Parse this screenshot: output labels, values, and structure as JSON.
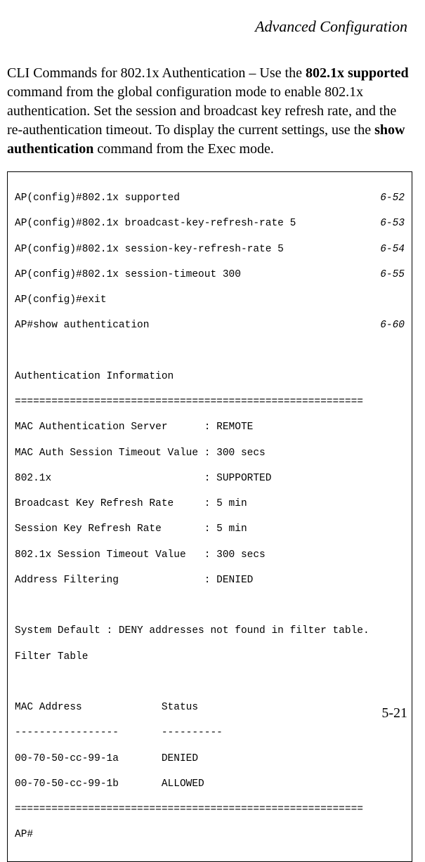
{
  "header": {
    "title": "Advanced Configuration"
  },
  "paragraph": {
    "part1": "CLI Commands for 802.1x Authentication – Use the ",
    "bold1": "802.1x supported",
    "part2": " command from the global configuration mode to enable 802.1x authentication. Set the session and broadcast key refresh rate, and the re-authentication timeout. To display the current settings, use the ",
    "bold2": "show authentication",
    "part3": " command from the Exec mode."
  },
  "cli": {
    "lines_with_ref": [
      {
        "cmd": "AP(config)#802.1x supported",
        "ref": "6-52"
      },
      {
        "cmd": "AP(config)#802.1x broadcast-key-refresh-rate 5",
        "ref": "6-53"
      },
      {
        "cmd": "AP(config)#802.1x session-key-refresh-rate 5",
        "ref": "6-54"
      },
      {
        "cmd": "AP(config)#802.1x session-timeout 300",
        "ref": "6-55"
      }
    ],
    "line_exit": "AP(config)#exit",
    "line_show": {
      "cmd": "AP#show authentication",
      "ref": "6-60"
    },
    "blank": "",
    "auth_header": "Authentication Information",
    "divider": "=========================================================",
    "info_lines": [
      "MAC Authentication Server      : REMOTE",
      "MAC Auth Session Timeout Value : 300 secs",
      "802.1x                         : SUPPORTED",
      "Broadcast Key Refresh Rate     : 5 min",
      "Session Key Refresh Rate       : 5 min",
      "802.1x Session Timeout Value   : 300 secs",
      "Address Filtering              : DENIED"
    ],
    "system_default": "System Default : DENY addresses not found in filter table.",
    "filter_table": "Filter Table",
    "mac_header": "MAC Address             Status",
    "mac_divider": "-----------------       ----------",
    "mac_rows": [
      "00-70-50-cc-99-1a       DENIED",
      "00-70-50-cc-99-1b       ALLOWED"
    ],
    "prompt": "AP#"
  },
  "page_number": "5-21"
}
